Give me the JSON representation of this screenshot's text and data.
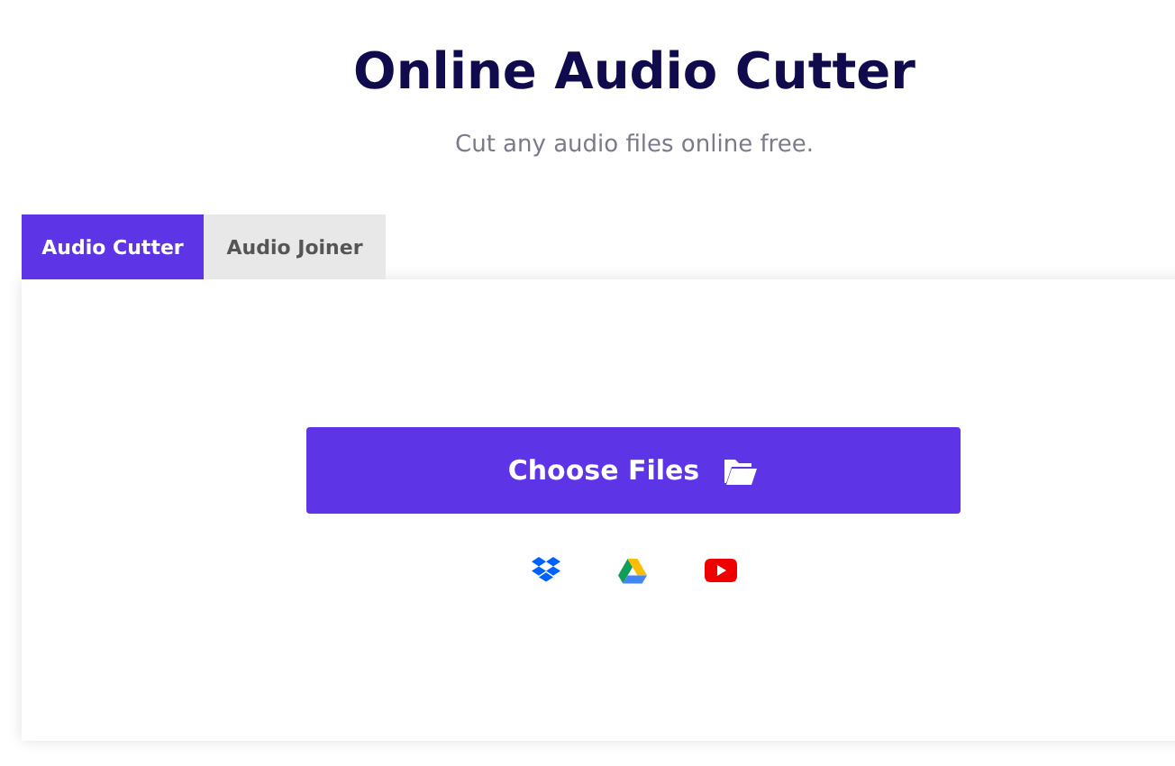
{
  "header": {
    "title": "Online Audio Cutter",
    "subtitle": "Cut any audio files online free."
  },
  "tabs": [
    {
      "label": "Audio Cutter",
      "selected": true
    },
    {
      "label": "Audio Joiner",
      "selected": false
    }
  ],
  "upload": {
    "button": "Choose Files"
  }
}
